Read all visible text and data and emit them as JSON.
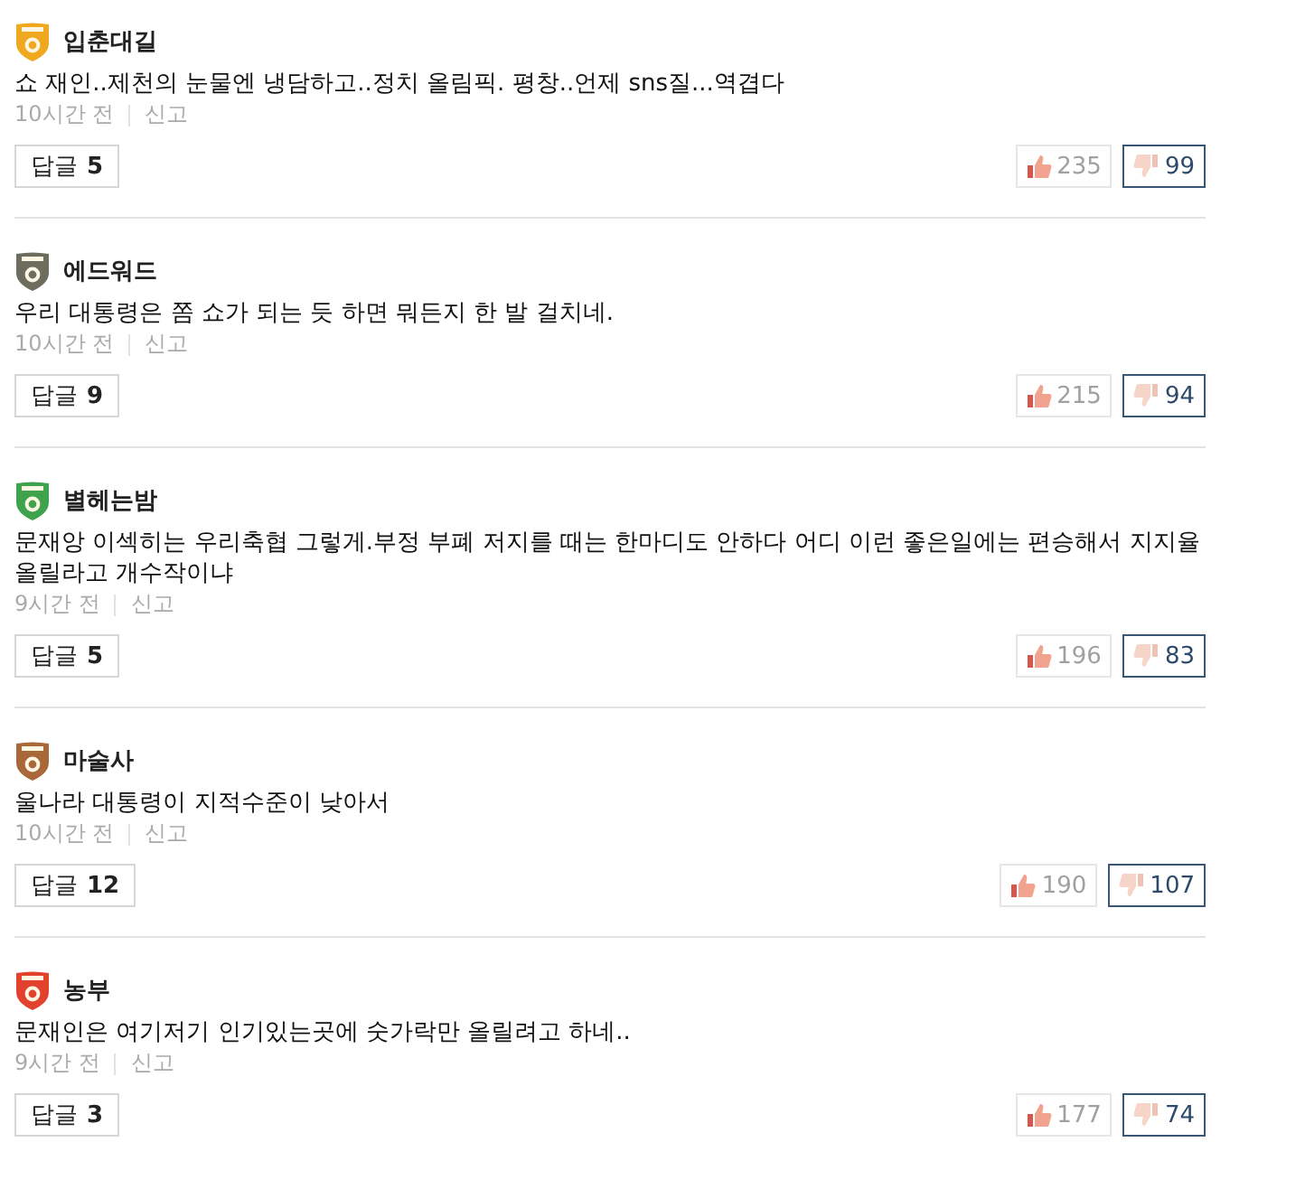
{
  "comments": [
    {
      "author": "입춘대길",
      "color": "#f0a820",
      "text": "쇼 재인..제천의 눈물엔 냉담하고..정치 올림픽. 평창..언제 sns질...역겹다",
      "time": "10시간 전",
      "report": "신고",
      "reply": {
        "label": "답글",
        "count": "5"
      },
      "votes": [
        {
          "kind": "like",
          "count": "235",
          "selected": false
        },
        {
          "kind": "dislike",
          "count": "99",
          "selected": true
        }
      ]
    },
    {
      "author": "에드워드",
      "color": "#6e6c5e",
      "text": "우리 대통령은 쫌 쇼가 되는 듯 하면 뭐든지 한 발 걸치네.",
      "time": "10시간 전",
      "report": "신고",
      "reply": {
        "label": "답글",
        "count": "9"
      },
      "votes": [
        {
          "kind": "like",
          "count": "215",
          "selected": false
        },
        {
          "kind": "dislike",
          "count": "94",
          "selected": true
        }
      ]
    },
    {
      "author": "별헤는밤",
      "color": "#3fa34d",
      "text": "문재앙 이섹히는 우리축협 그렇게.부정 부폐 저지를 때는 한마디도 안하다 어디 이런 좋은일에는 편승해서 지지율 올릴라고 개수작이냐",
      "time": "9시간 전",
      "report": "신고",
      "reply": {
        "label": "답글",
        "count": "5"
      },
      "votes": [
        {
          "kind": "like",
          "count": "196",
          "selected": false
        },
        {
          "kind": "dislike",
          "count": "83",
          "selected": true
        }
      ]
    },
    {
      "author": "마술사",
      "color": "#a8683a",
      "text": "울나라 대통령이 지적수준이 낮아서",
      "time": "10시간 전",
      "report": "신고",
      "reply": {
        "label": "답글",
        "count": "12"
      },
      "votes": [
        {
          "kind": "like",
          "count": "190",
          "selected": false
        },
        {
          "kind": "dislike",
          "count": "107",
          "selected": true
        }
      ]
    },
    {
      "author": "농부",
      "color": "#e2412e",
      "text": "문재인은 여기저기 인기있는곳에 숫가락만 올릴려고 하네..",
      "time": "9시간 전",
      "report": "신고",
      "reply": {
        "label": "답글",
        "count": "3"
      },
      "votes": [
        {
          "kind": "like",
          "count": "177",
          "selected": false
        },
        {
          "kind": "dislike",
          "count": "74",
          "selected": true
        }
      ]
    }
  ]
}
